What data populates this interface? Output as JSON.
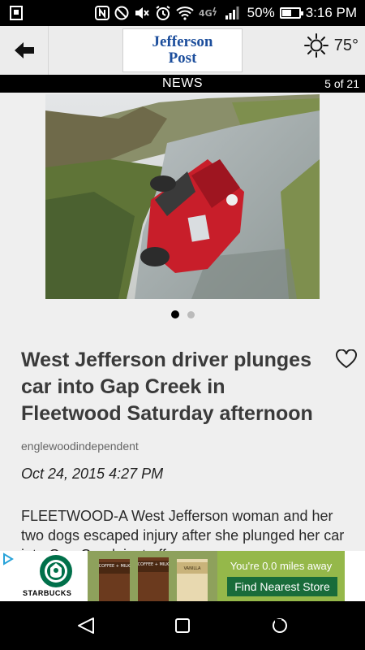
{
  "status_bar": {
    "battery": "50%",
    "time": "3:16 PM",
    "battery_level": 0.5,
    "network": "4G",
    "icons": [
      "notification-icon",
      "nfc-icon",
      "blocked-icon",
      "mute-icon",
      "alarm-icon",
      "wifi-icon",
      "signal-icon"
    ]
  },
  "header": {
    "logo_line1": "Jefferson",
    "logo_line2": "Post",
    "temperature": "75°",
    "back_icon": "arrow-left-icon",
    "weather_icon": "sun-icon"
  },
  "section_bar": {
    "label": "NEWS",
    "counter": "5 of 21"
  },
  "article": {
    "headline": "West Jefferson driver plunges car into Gap Creek in Fleetwood Saturday afternoon",
    "source": "englewoodindependent",
    "date": "Oct 24, 2015 4:27 PM",
    "body": "FLEETWOOD-A West Jefferson woman and her two dogs escaped injury after she plunged her car into Gap Creek just off",
    "carousel": {
      "total": 2,
      "active": 1
    }
  },
  "ad": {
    "brand": "STARBUCKS",
    "distance_text": "You're 0.0 miles away",
    "cta": "Find Nearest Store",
    "cup_labels": [
      "COFFEE + MILK",
      "COFFEE + MILK",
      "VANILLA"
    ]
  },
  "colors": {
    "logo_blue": "#1c4e9c",
    "ad_green": "#95b84a",
    "cta_green": "#196c3a"
  }
}
